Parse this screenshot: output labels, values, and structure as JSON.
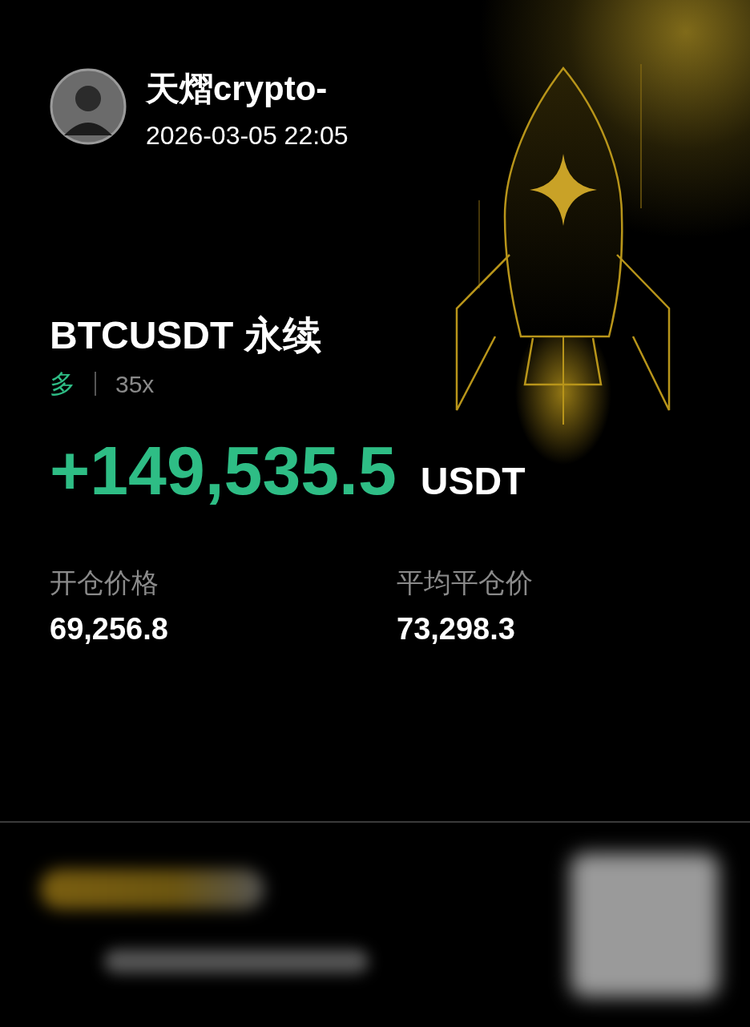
{
  "user": {
    "name": "天熠crypto-",
    "time": "2026-03-05 22:05"
  },
  "position": {
    "symbol": "BTCUSDT 永续",
    "side": {
      "text": "多",
      "kind": "long"
    },
    "leverage": "35x"
  },
  "pnl": {
    "amount": "+149,535.5",
    "unit": "USDT"
  },
  "stats": [
    {
      "label": "开仓价格",
      "value": "69,256.8"
    },
    {
      "label": "平均平仓价",
      "value": "73,298.3"
    }
  ]
}
